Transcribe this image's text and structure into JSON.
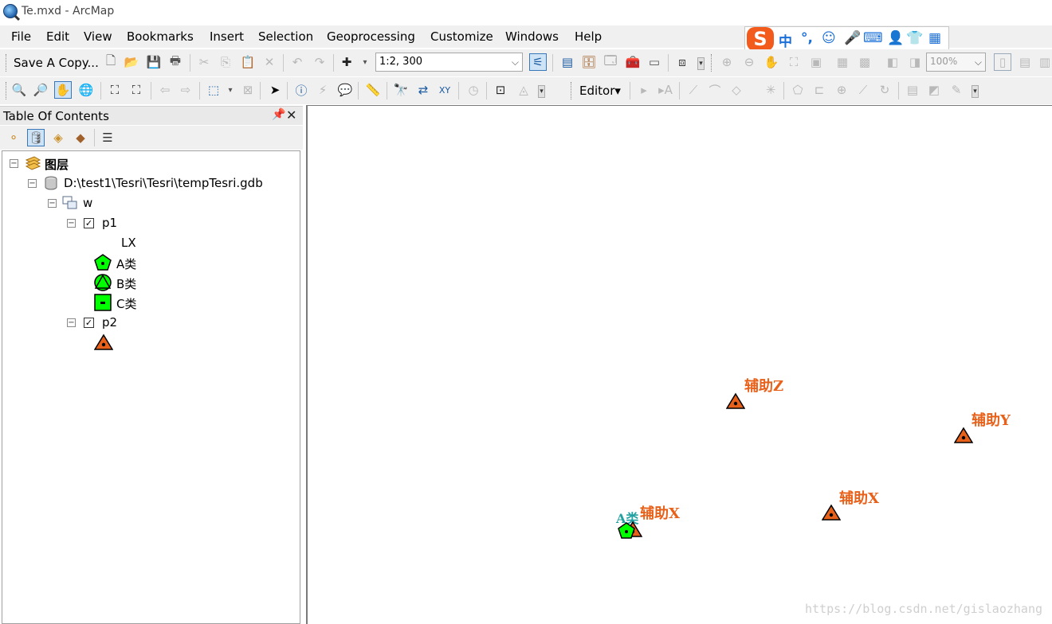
{
  "window": {
    "title": "Te.mxd - ArcMap"
  },
  "menu": [
    "File",
    "Edit",
    "View",
    "Bookmarks",
    "Insert",
    "Selection",
    "Geoprocessing",
    "Customize",
    "Windows",
    "Help"
  ],
  "ime": {
    "logo": "S",
    "glyphs": [
      "中",
      "°,",
      "☺",
      "🎤",
      "⌨",
      "👤",
      "👕",
      "▦"
    ]
  },
  "toolbar1": {
    "save_copy": "Save A Copy...",
    "scale": "1:2, 300",
    "zoom": "100%"
  },
  "toolbar2": {
    "editor": "Editor▾"
  },
  "toc": {
    "title": "Table Of Contents",
    "pin": "ᵖ",
    "close": "✕",
    "tree": {
      "root": "图层",
      "gdb": "D:\\test1\\Tesri\\Tesri\\tempTesri.gdb",
      "group": "w",
      "layer_p1": "p1",
      "field": "LX",
      "classes": [
        "A类",
        "B类",
        "C类"
      ],
      "layer_p2": "p2"
    }
  },
  "map": {
    "labels": [
      {
        "text": "辅助Z",
        "style": "orange"
      },
      {
        "text": "辅助Y",
        "style": "orange"
      },
      {
        "text": "辅助X",
        "style": "orange"
      },
      {
        "text": "辅助X",
        "style": "orange"
      },
      {
        "text": "A类",
        "style": "teal"
      }
    ],
    "colors": {
      "triangle": "#e8611a",
      "pentagon": "#00ff00",
      "label": "#e8611a",
      "teal": "#20a0a0"
    }
  },
  "watermark": "https://blog.csdn.net/gislaozhang"
}
